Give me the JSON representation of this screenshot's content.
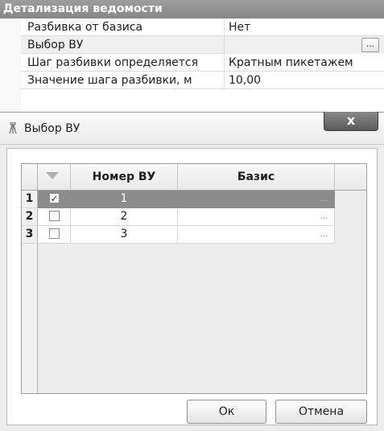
{
  "property_grid": {
    "header": "Детализация ведомости",
    "rows": [
      {
        "name": "Разбивка от базиса",
        "value": "Нет"
      },
      {
        "name": "Выбор ВУ",
        "value": "",
        "button": "..."
      },
      {
        "name": "Шаг разбивки определяется",
        "value": "Кратным пикетажем"
      },
      {
        "name": "Значение шага разбивки, м",
        "value": "10,00"
      }
    ]
  },
  "dialog": {
    "title": "Выбор ВУ",
    "close_glyph": "x",
    "icon": "surveyor-icon",
    "grid": {
      "columns": [
        "",
        "",
        "Номер ВУ",
        "Базис"
      ],
      "rows": [
        {
          "idx": "1",
          "checked": true,
          "number": "1",
          "basis": "...",
          "selected": true
        },
        {
          "idx": "2",
          "checked": false,
          "number": "2",
          "basis": "...",
          "selected": false
        },
        {
          "idx": "3",
          "checked": false,
          "number": "3",
          "basis": "...",
          "selected": false
        }
      ]
    },
    "buttons": {
      "ok": "Ок",
      "cancel": "Отмена"
    }
  }
}
